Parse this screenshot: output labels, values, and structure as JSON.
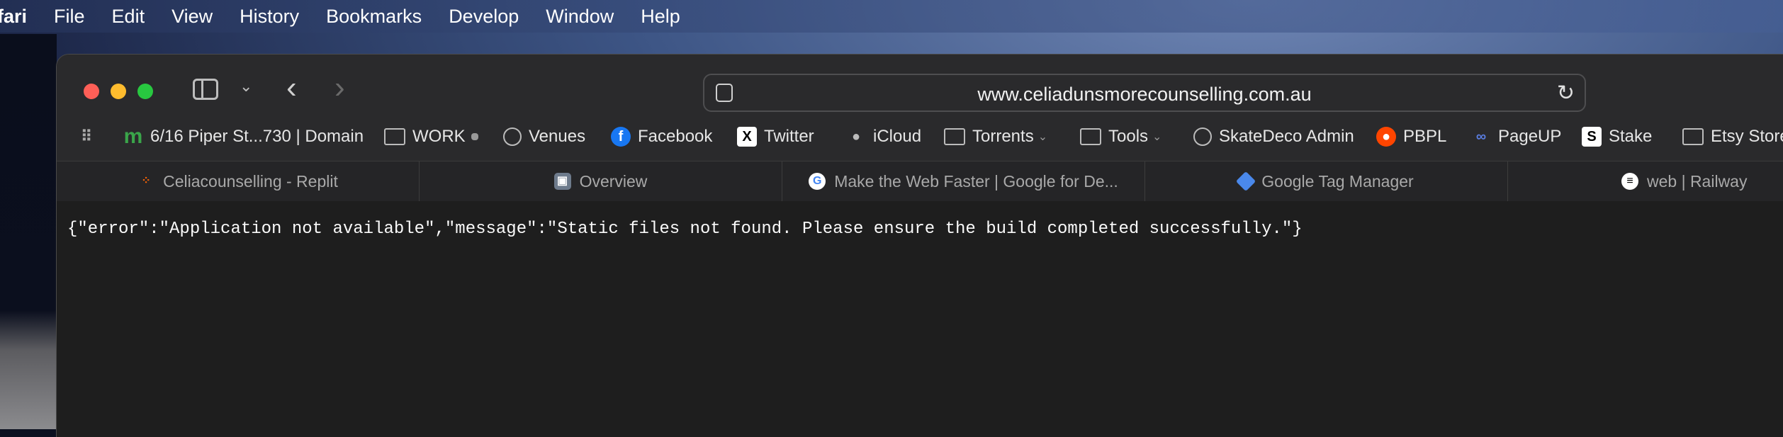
{
  "menubar": {
    "app_name": "fari",
    "items": [
      "File",
      "Edit",
      "View",
      "History",
      "Bookmarks",
      "Develop",
      "Window",
      "Help"
    ]
  },
  "toolbar": {
    "url": "www.celiadunsmorecounselling.com.au"
  },
  "bookmarks": [
    {
      "label": "6/16 Piper St...730 | Domain",
      "icon": "domain-icon"
    },
    {
      "label": "WORK",
      "icon": "folder-icon"
    },
    {
      "label": "Venues",
      "icon": "globe-icon"
    },
    {
      "label": "Facebook",
      "icon": "facebook-icon"
    },
    {
      "label": "Twitter",
      "icon": "x-icon"
    },
    {
      "label": "iCloud",
      "icon": "apple-icon"
    },
    {
      "label": "Torrents",
      "icon": "folder-icon"
    },
    {
      "label": "Tools",
      "icon": "folder-icon"
    },
    {
      "label": "SkateDeco Admin",
      "icon": "globe-icon"
    },
    {
      "label": "PBPL",
      "icon": "reddit-icon"
    },
    {
      "label": "PageUP",
      "icon": "pageup-icon"
    },
    {
      "label": "Stake",
      "icon": "stake-icon"
    },
    {
      "label": "Etsy Store",
      "icon": "folder-icon"
    }
  ],
  "tabs": [
    {
      "label": "Celiacounselling - Replit",
      "icon": "replit-icon"
    },
    {
      "label": "Overview",
      "icon": "overview-icon"
    },
    {
      "label": "Make the Web Faster  |  Google for De...",
      "icon": "google-icon"
    },
    {
      "label": "Google Tag Manager",
      "icon": "gtm-icon"
    },
    {
      "label": "web | Railway",
      "icon": "railway-icon"
    }
  ],
  "page": {
    "body_text": "{\"error\":\"Application not available\",\"message\":\"Static files not found. Please ensure the build completed successfully.\"}"
  },
  "colors": {
    "close": "#fe5f57",
    "minimize": "#febc2e",
    "zoom": "#28c840"
  }
}
